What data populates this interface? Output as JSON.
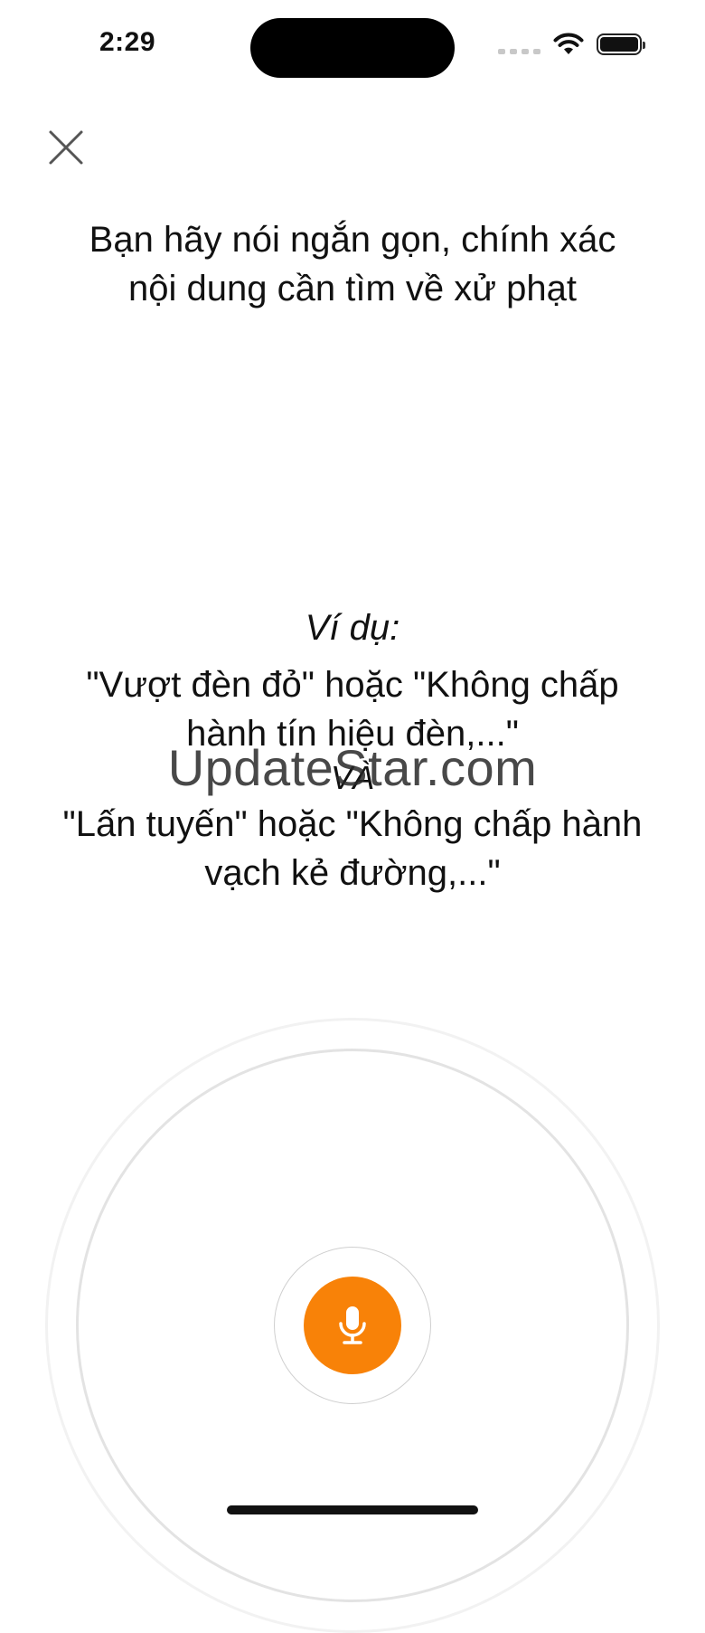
{
  "status_bar": {
    "time": "2:29"
  },
  "header": {
    "close_icon": "close-icon"
  },
  "instruction": {
    "line1": "Bạn hãy nói ngắn gọn, chính xác",
    "line2": "nội dung cần tìm về xử phạt"
  },
  "example": {
    "title": "Ví dụ:",
    "example1_line1": "\"Vượt đèn đỏ\" hoặc \"Không chấp",
    "example1_line2": "hành tín hiệu đèn,...\"",
    "connector": "VÀ",
    "example2_line1": "\"Lấn tuyến\" hoặc \"Không chấp hành",
    "example2_line2": "vạch kẻ đường,...\""
  },
  "watermark": "UpdateStar.com",
  "mic": {
    "icon": "microphone-icon",
    "color": "#f88208"
  }
}
